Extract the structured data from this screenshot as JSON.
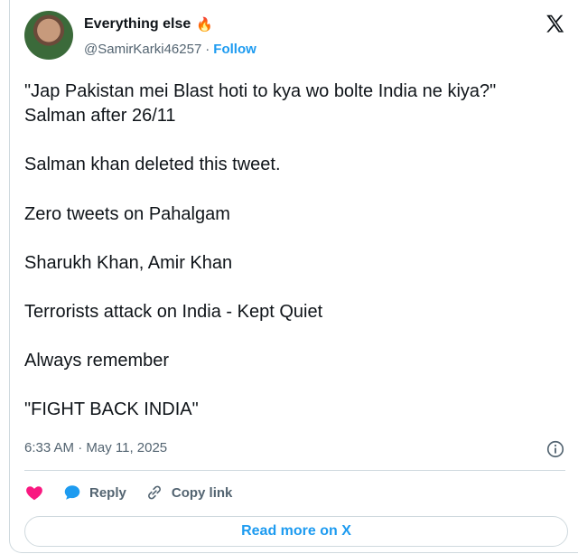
{
  "author": {
    "name": "Everything else",
    "name_emoji": "🔥",
    "handle": "@SamirKarki46257",
    "separator": "·",
    "follow_label": "Follow"
  },
  "tweet": {
    "lines": [
      "\"Jap Pakistan mei Blast hoti to kya wo bolte India ne kiya?\"",
      "Salman after 26/11",
      "",
      "Salman khan deleted this tweet.",
      "",
      "Zero tweets on Pahalgam",
      "",
      "Sharukh Khan, Amir Khan",
      "",
      "Terrorists attack on India - Kept Quiet",
      "",
      "Always remember",
      "",
      "\"FIGHT BACK INDIA\""
    ],
    "timestamp": "6:33 AM · May 11, 2025"
  },
  "actions": {
    "reply_label": "Reply",
    "copy_link_label": "Copy link"
  },
  "read_more_label": "Read more on X",
  "icons": [
    "avatar",
    "x-logo-icon",
    "info-icon",
    "heart-icon",
    "reply-bubble-icon",
    "link-icon"
  ],
  "colors": {
    "text": "#0f1419",
    "secondary": "#536471",
    "accent": "#1d9bf0",
    "heart": "#f91880",
    "border": "#cfd9de"
  }
}
